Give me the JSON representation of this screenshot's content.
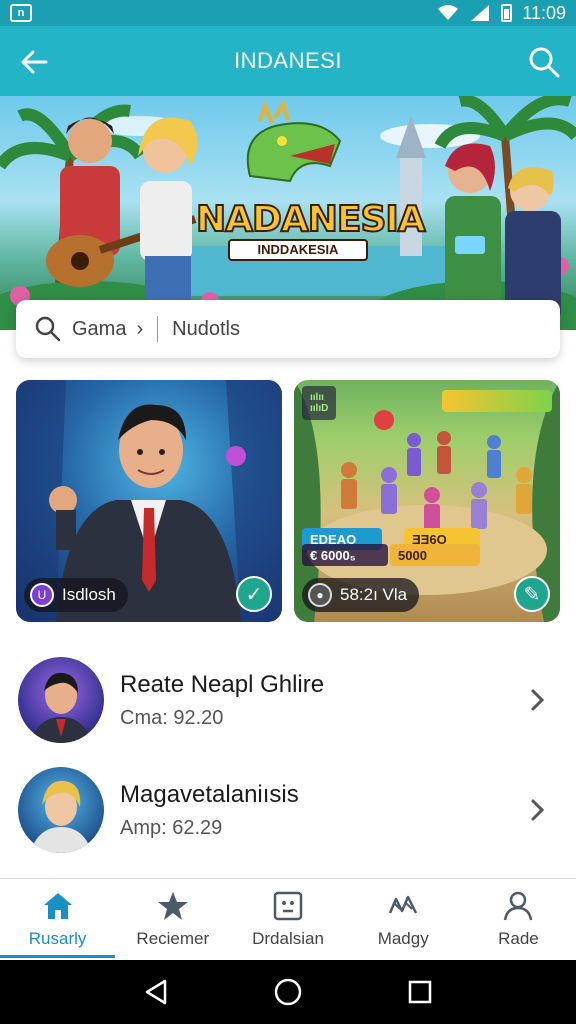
{
  "status": {
    "time": "11:09",
    "left_icon": "app-notification-icon"
  },
  "app_bar": {
    "title": "INDANESI",
    "back_icon": "arrow-left-icon",
    "search_icon": "search-icon"
  },
  "hero": {
    "title": "NADANESIA",
    "subtitle": "INDDAKESIA"
  },
  "search": {
    "prefix": "Gama",
    "separator": "›",
    "value": "Nudotls"
  },
  "cards": [
    {
      "pill_label": "Isdlosh",
      "pill_color": "#7b3fd6",
      "corner_icon": "check-icon"
    },
    {
      "pill_label": "58:2ı Vla",
      "pill_color": "#555555",
      "corner_icon": "edit-icon",
      "stats": {
        "tl_label": "ıılıı",
        "tl_sub": "ıılıD",
        "bar_label": "EDEAO",
        "value_left": "€ 6000₅",
        "value_right": "ƎƎ6O",
        "value_bottom": "5000"
      }
    }
  ],
  "list": [
    {
      "title": "Reate Neapl Ghlire",
      "subtitle": "Cma: 92.20"
    },
    {
      "title": "Magavetalaniısis",
      "subtitle": "Amp: 62.29"
    }
  ],
  "bottom_nav": [
    {
      "label": "Rusarly",
      "icon": "home-icon",
      "active": true
    },
    {
      "label": "Reciemer",
      "icon": "star-icon",
      "active": false
    },
    {
      "label": "Drdalsian",
      "icon": "face-box-icon",
      "active": false
    },
    {
      "label": "Madgy",
      "icon": "graph-icon",
      "active": false
    },
    {
      "label": "Rade",
      "icon": "user-icon",
      "active": false
    }
  ],
  "colors": {
    "primary": "#23b4c8",
    "status_bar": "#1a9fb3",
    "nav_active": "#1a8fc5",
    "accent_green": "#1ea68e"
  }
}
